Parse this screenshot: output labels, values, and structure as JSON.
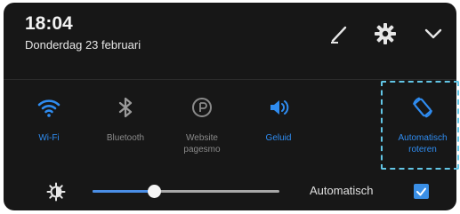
{
  "header": {
    "time": "18:04",
    "date": "Donderdag 23 februari"
  },
  "icons": {
    "edit": "pencil-icon",
    "settings": "gear-icon",
    "expand": "chevron-down-icon"
  },
  "toggles": [
    {
      "label": "Wi-Fi",
      "icon": "wifi-icon",
      "active": true
    },
    {
      "label": "Bluetooth",
      "icon": "bluetooth-icon",
      "active": false
    },
    {
      "label": "Website\npagesmo",
      "icon": "website-icon",
      "active": false
    },
    {
      "label": "Geluid",
      "icon": "sound-icon",
      "active": true
    },
    {
      "label": "Automatisch\nroteren",
      "icon": "auto-rotate-icon",
      "active": true
    }
  ],
  "brightness": {
    "level": 0.33,
    "auto_label": "Automatisch",
    "auto_checked": true
  },
  "colors": {
    "panel_bg": "#171717",
    "accent": "#2f8cf0",
    "inactive": "#8a8a8a",
    "highlight_border": "#62c6e6"
  }
}
